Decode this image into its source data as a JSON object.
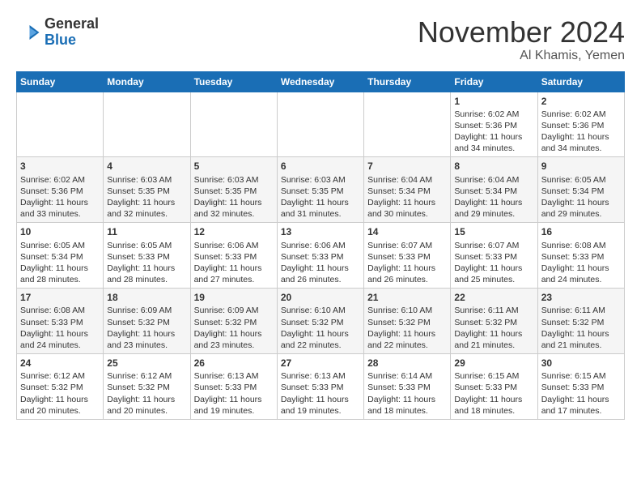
{
  "logo": {
    "general": "General",
    "blue": "Blue"
  },
  "title": {
    "month": "November 2024",
    "location": "Al Khamis, Yemen"
  },
  "weekdays": [
    "Sunday",
    "Monday",
    "Tuesday",
    "Wednesday",
    "Thursday",
    "Friday",
    "Saturday"
  ],
  "weeks": [
    [
      {
        "day": "",
        "sunrise": "",
        "sunset": "",
        "daylight": ""
      },
      {
        "day": "",
        "sunrise": "",
        "sunset": "",
        "daylight": ""
      },
      {
        "day": "",
        "sunrise": "",
        "sunset": "",
        "daylight": ""
      },
      {
        "day": "",
        "sunrise": "",
        "sunset": "",
        "daylight": ""
      },
      {
        "day": "",
        "sunrise": "",
        "sunset": "",
        "daylight": ""
      },
      {
        "day": "1",
        "sunrise": "Sunrise: 6:02 AM",
        "sunset": "Sunset: 5:36 PM",
        "daylight": "Daylight: 11 hours and 34 minutes."
      },
      {
        "day": "2",
        "sunrise": "Sunrise: 6:02 AM",
        "sunset": "Sunset: 5:36 PM",
        "daylight": "Daylight: 11 hours and 34 minutes."
      }
    ],
    [
      {
        "day": "3",
        "sunrise": "Sunrise: 6:02 AM",
        "sunset": "Sunset: 5:36 PM",
        "daylight": "Daylight: 11 hours and 33 minutes."
      },
      {
        "day": "4",
        "sunrise": "Sunrise: 6:03 AM",
        "sunset": "Sunset: 5:35 PM",
        "daylight": "Daylight: 11 hours and 32 minutes."
      },
      {
        "day": "5",
        "sunrise": "Sunrise: 6:03 AM",
        "sunset": "Sunset: 5:35 PM",
        "daylight": "Daylight: 11 hours and 32 minutes."
      },
      {
        "day": "6",
        "sunrise": "Sunrise: 6:03 AM",
        "sunset": "Sunset: 5:35 PM",
        "daylight": "Daylight: 11 hours and 31 minutes."
      },
      {
        "day": "7",
        "sunrise": "Sunrise: 6:04 AM",
        "sunset": "Sunset: 5:34 PM",
        "daylight": "Daylight: 11 hours and 30 minutes."
      },
      {
        "day": "8",
        "sunrise": "Sunrise: 6:04 AM",
        "sunset": "Sunset: 5:34 PM",
        "daylight": "Daylight: 11 hours and 29 minutes."
      },
      {
        "day": "9",
        "sunrise": "Sunrise: 6:05 AM",
        "sunset": "Sunset: 5:34 PM",
        "daylight": "Daylight: 11 hours and 29 minutes."
      }
    ],
    [
      {
        "day": "10",
        "sunrise": "Sunrise: 6:05 AM",
        "sunset": "Sunset: 5:34 PM",
        "daylight": "Daylight: 11 hours and 28 minutes."
      },
      {
        "day": "11",
        "sunrise": "Sunrise: 6:05 AM",
        "sunset": "Sunset: 5:33 PM",
        "daylight": "Daylight: 11 hours and 28 minutes."
      },
      {
        "day": "12",
        "sunrise": "Sunrise: 6:06 AM",
        "sunset": "Sunset: 5:33 PM",
        "daylight": "Daylight: 11 hours and 27 minutes."
      },
      {
        "day": "13",
        "sunrise": "Sunrise: 6:06 AM",
        "sunset": "Sunset: 5:33 PM",
        "daylight": "Daylight: 11 hours and 26 minutes."
      },
      {
        "day": "14",
        "sunrise": "Sunrise: 6:07 AM",
        "sunset": "Sunset: 5:33 PM",
        "daylight": "Daylight: 11 hours and 26 minutes."
      },
      {
        "day": "15",
        "sunrise": "Sunrise: 6:07 AM",
        "sunset": "Sunset: 5:33 PM",
        "daylight": "Daylight: 11 hours and 25 minutes."
      },
      {
        "day": "16",
        "sunrise": "Sunrise: 6:08 AM",
        "sunset": "Sunset: 5:33 PM",
        "daylight": "Daylight: 11 hours and 24 minutes."
      }
    ],
    [
      {
        "day": "17",
        "sunrise": "Sunrise: 6:08 AM",
        "sunset": "Sunset: 5:33 PM",
        "daylight": "Daylight: 11 hours and 24 minutes."
      },
      {
        "day": "18",
        "sunrise": "Sunrise: 6:09 AM",
        "sunset": "Sunset: 5:32 PM",
        "daylight": "Daylight: 11 hours and 23 minutes."
      },
      {
        "day": "19",
        "sunrise": "Sunrise: 6:09 AM",
        "sunset": "Sunset: 5:32 PM",
        "daylight": "Daylight: 11 hours and 23 minutes."
      },
      {
        "day": "20",
        "sunrise": "Sunrise: 6:10 AM",
        "sunset": "Sunset: 5:32 PM",
        "daylight": "Daylight: 11 hours and 22 minutes."
      },
      {
        "day": "21",
        "sunrise": "Sunrise: 6:10 AM",
        "sunset": "Sunset: 5:32 PM",
        "daylight": "Daylight: 11 hours and 22 minutes."
      },
      {
        "day": "22",
        "sunrise": "Sunrise: 6:11 AM",
        "sunset": "Sunset: 5:32 PM",
        "daylight": "Daylight: 11 hours and 21 minutes."
      },
      {
        "day": "23",
        "sunrise": "Sunrise: 6:11 AM",
        "sunset": "Sunset: 5:32 PM",
        "daylight": "Daylight: 11 hours and 21 minutes."
      }
    ],
    [
      {
        "day": "24",
        "sunrise": "Sunrise: 6:12 AM",
        "sunset": "Sunset: 5:32 PM",
        "daylight": "Daylight: 11 hours and 20 minutes."
      },
      {
        "day": "25",
        "sunrise": "Sunrise: 6:12 AM",
        "sunset": "Sunset: 5:32 PM",
        "daylight": "Daylight: 11 hours and 20 minutes."
      },
      {
        "day": "26",
        "sunrise": "Sunrise: 6:13 AM",
        "sunset": "Sunset: 5:33 PM",
        "daylight": "Daylight: 11 hours and 19 minutes."
      },
      {
        "day": "27",
        "sunrise": "Sunrise: 6:13 AM",
        "sunset": "Sunset: 5:33 PM",
        "daylight": "Daylight: 11 hours and 19 minutes."
      },
      {
        "day": "28",
        "sunrise": "Sunrise: 6:14 AM",
        "sunset": "Sunset: 5:33 PM",
        "daylight": "Daylight: 11 hours and 18 minutes."
      },
      {
        "day": "29",
        "sunrise": "Sunrise: 6:15 AM",
        "sunset": "Sunset: 5:33 PM",
        "daylight": "Daylight: 11 hours and 18 minutes."
      },
      {
        "day": "30",
        "sunrise": "Sunrise: 6:15 AM",
        "sunset": "Sunset: 5:33 PM",
        "daylight": "Daylight: 11 hours and 17 minutes."
      }
    ]
  ]
}
